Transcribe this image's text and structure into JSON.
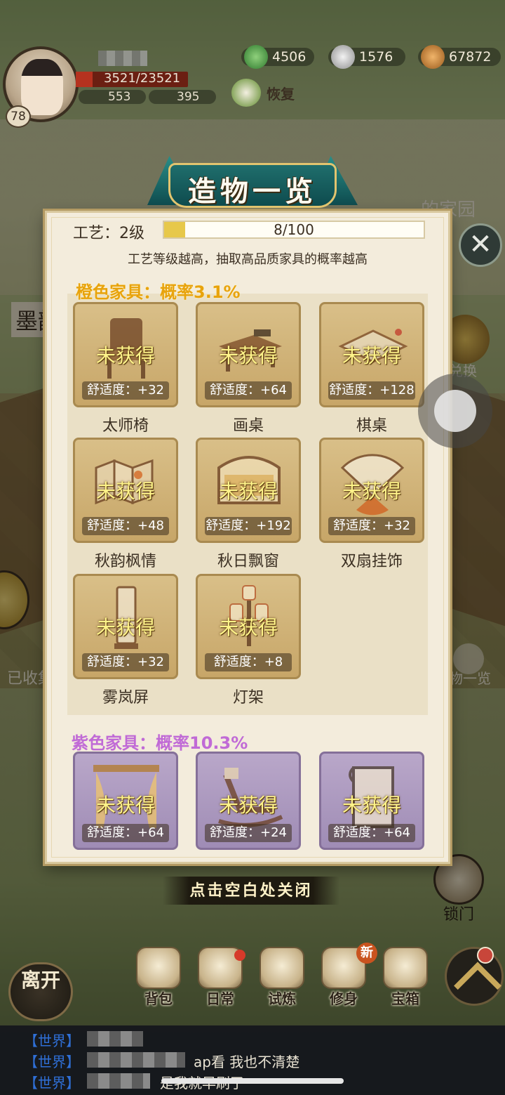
{
  "hud": {
    "player_level": "78",
    "hp_text": "3521/23521",
    "stat_a": "553",
    "stat_b": "395",
    "res_jade": "4506",
    "res_silver": "1576",
    "res_coins": "67872",
    "restore_label": "恢复",
    "hp_fill_percent": 15
  },
  "background": {
    "garden_label": "的家园",
    "left_tab_label": "墨韵",
    "exchange_label": "兑换",
    "collected_label": "已收集",
    "catalog_label": "造物一览",
    "lock_door_label": "锁门"
  },
  "modal": {
    "title": "造物一览",
    "craft_label": "工艺：2级",
    "craft_progress_text": "8/100",
    "craft_progress": 0.08,
    "hint": "工艺等级越高，抽取高品质家具的概率越高",
    "close_hint": "点击空白处关闭",
    "sections": [
      {
        "title": "橙色家具：概率3.1%",
        "items": [
          {
            "name": "太师椅",
            "status": "未获得",
            "comfort": "舒适度：+32"
          },
          {
            "name": "画桌",
            "status": "未获得",
            "comfort": "舒适度：+64"
          },
          {
            "name": "棋桌",
            "status": "未获得",
            "comfort": "舒适度：+128"
          },
          {
            "name": "秋韵枫情",
            "status": "未获得",
            "comfort": "舒适度：+48"
          },
          {
            "name": "秋日飘窗",
            "status": "未获得",
            "comfort": "舒适度：+192"
          },
          {
            "name": "双扇挂饰",
            "status": "未获得",
            "comfort": "舒适度：+32"
          },
          {
            "name": "雾岚屏",
            "status": "未获得",
            "comfort": "舒适度：+32"
          },
          {
            "name": "灯架",
            "status": "未获得",
            "comfort": "舒适度：+8"
          }
        ]
      },
      {
        "title": "紫色家具：概率10.3%",
        "items": [
          {
            "status": "未获得",
            "comfort": "舒适度：+64"
          },
          {
            "status": "未获得",
            "comfort": "舒适度：+24"
          },
          {
            "status": "未获得",
            "comfort": "舒适度：+64"
          }
        ]
      }
    ]
  },
  "bottom_nav": {
    "leave_label": "离开",
    "items": [
      "背包",
      "日常",
      "试炼",
      "修身",
      "宝箱"
    ],
    "new_badge": "新"
  },
  "chat": {
    "channel": "【世界】",
    "line2_msg": "ap看 我也不清楚",
    "line3_msg": "是我就早刷了"
  },
  "colors": {
    "orange_title": "#e8a30c",
    "purple_title": "#c06ad6",
    "status_text": "#fff48a",
    "title_plate": "#1f6e6c"
  }
}
